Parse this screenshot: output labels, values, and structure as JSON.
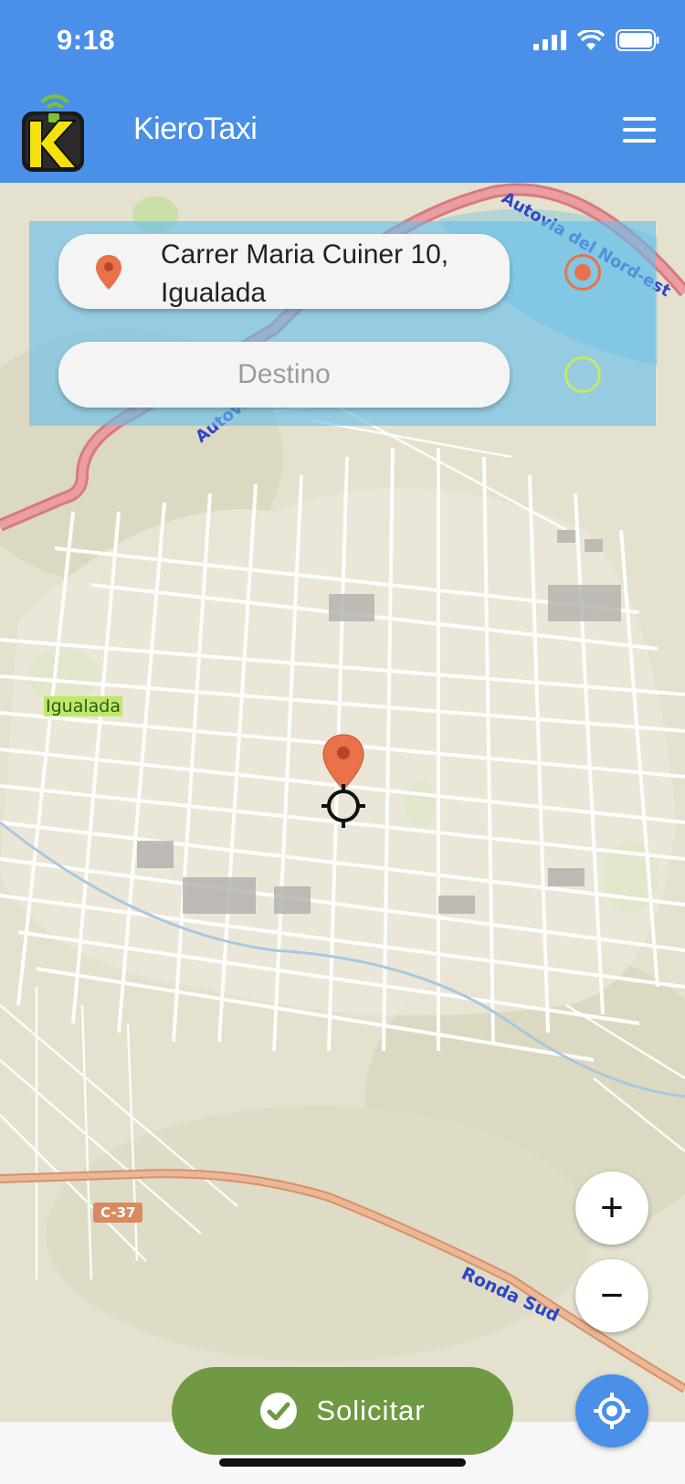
{
  "status_bar": {
    "time": "9:18"
  },
  "header": {
    "app_title": "KieroTaxi"
  },
  "panel": {
    "origin_address": "Carrer Maria Cuiner 10, Igualada",
    "destination_placeholder": "Destino"
  },
  "map": {
    "labels": {
      "town": "Igualada",
      "road_c37": "C-37",
      "road_autovia_top": "Autovia del Nord-est",
      "road_autovia_left": "Autovia",
      "road_ronda": "Ronda Sud"
    }
  },
  "controls": {
    "zoom_in": "+",
    "zoom_out": "−"
  },
  "actions": {
    "request_label": "Solicitar"
  },
  "colors": {
    "header_blue": "#4a90e8",
    "pin_orange": "#e9724a",
    "request_green": "#6f9a43",
    "dest_radio_green": "#c4e86a"
  }
}
